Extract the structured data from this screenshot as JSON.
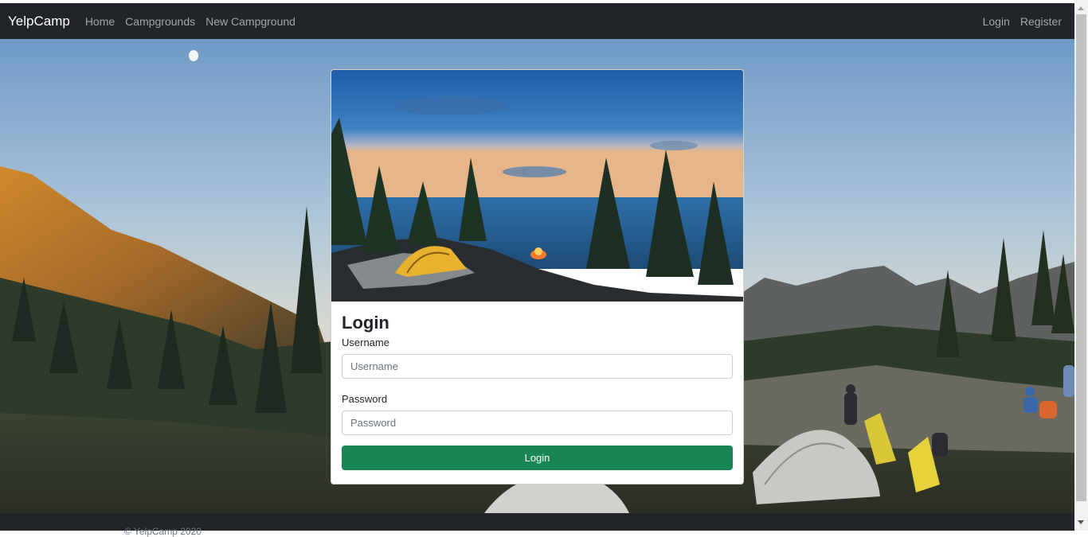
{
  "navbar": {
    "brand": "YelpCamp",
    "links": [
      "Home",
      "Campgrounds",
      "New Campground"
    ],
    "auth_links": [
      "Login",
      "Register"
    ]
  },
  "login_card": {
    "title": "Login",
    "username_label": "Username",
    "username_placeholder": "Username",
    "password_label": "Password",
    "password_placeholder": "Password",
    "submit_label": "Login"
  },
  "footer": {
    "text": "© YelpCamp 2020"
  },
  "colors": {
    "navbar_bg": "#212529",
    "button_bg": "#198754",
    "link_muted": "#9a9c9e"
  }
}
